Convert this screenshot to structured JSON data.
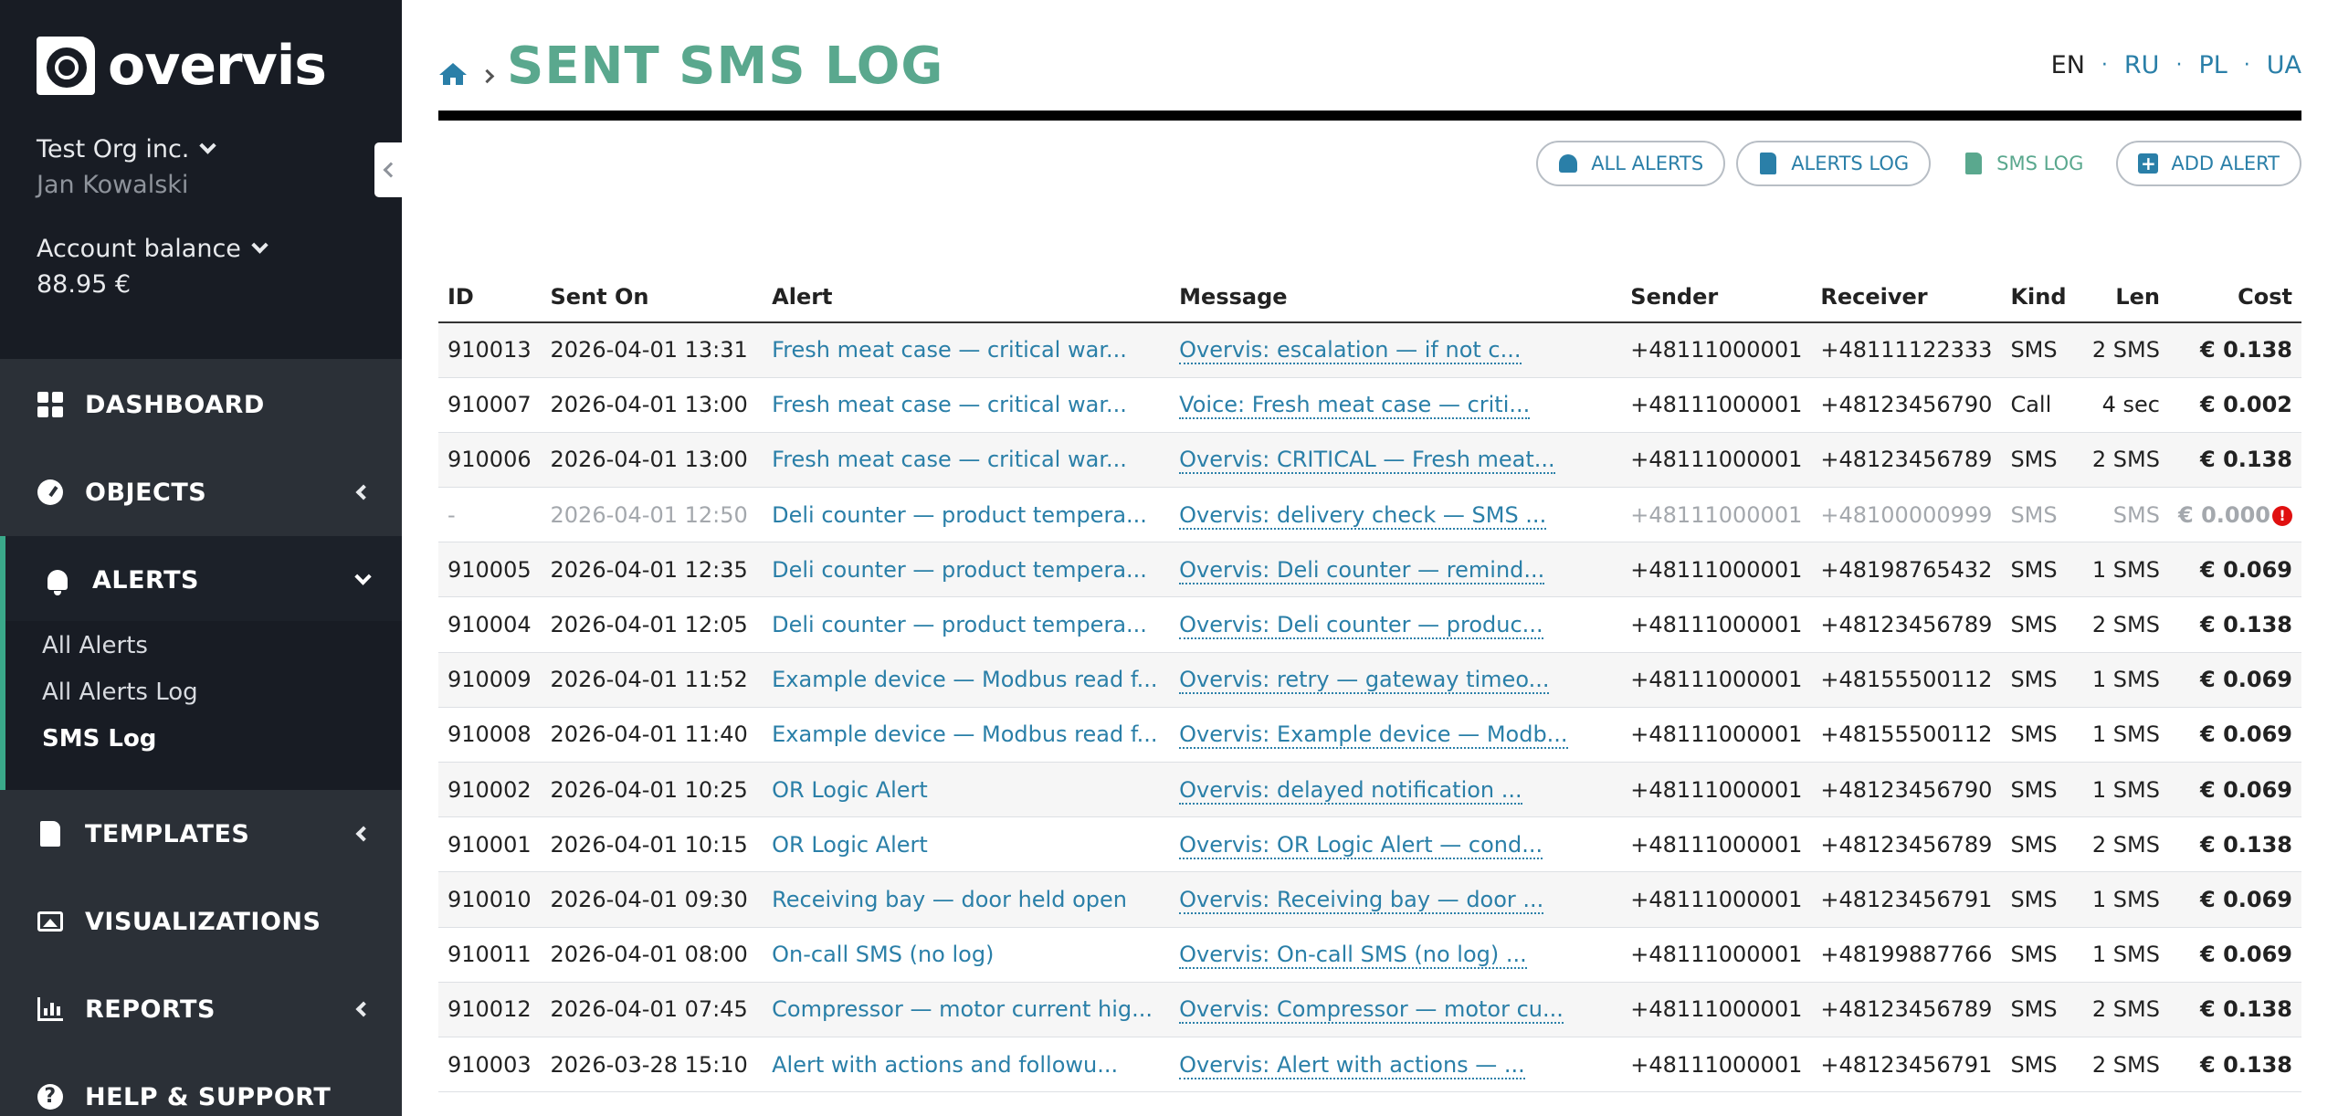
{
  "sidebar": {
    "logo_text": "overvis",
    "org_name": "Test Org inc.",
    "user_name": "Jan Kowalski",
    "balance_label": "Account balance",
    "balance_value": "88.95 €",
    "nav": [
      {
        "label": "DASHBOARD",
        "icon": "dashboard-icon"
      },
      {
        "label": "OBJECTS",
        "icon": "gauge-icon"
      },
      {
        "label": "ALERTS",
        "icon": "bell-icon"
      },
      {
        "label": "TEMPLATES",
        "icon": "file-icon"
      },
      {
        "label": "VISUALIZATIONS",
        "icon": "image-icon"
      },
      {
        "label": "REPORTS",
        "icon": "bar-chart-icon"
      },
      {
        "label": "HELP & SUPPORT",
        "icon": "help-icon"
      }
    ],
    "alerts_submenu": [
      "All Alerts",
      "All Alerts Log",
      "SMS Log"
    ]
  },
  "header": {
    "title": "SENT SMS LOG",
    "languages": [
      "EN",
      "RU",
      "PL",
      "UA"
    ],
    "current_language": "EN"
  },
  "actions": {
    "all_alerts": "ALL ALERTS",
    "alerts_log": "ALERTS LOG",
    "sms_log": "SMS LOG",
    "add_alert": "ADD ALERT"
  },
  "table": {
    "columns": [
      "ID",
      "Sent On",
      "Alert",
      "Message",
      "Sender",
      "Receiver",
      "Kind",
      "Len",
      "Cost"
    ],
    "rows": [
      {
        "id": "910013",
        "sent_on": "2026-04-01 13:31",
        "alert": "Fresh meat case — critical war...",
        "message": "Overvis: escalation — if not c...",
        "sender": "+48111000001",
        "receiver": "+48111122333",
        "kind": "SMS",
        "len": "2 SMS",
        "cost": "€ 0.138"
      },
      {
        "id": "910007",
        "sent_on": "2026-04-01 13:00",
        "alert": "Fresh meat case — critical war...",
        "message": "Voice: Fresh meat case — criti...",
        "sender": "+48111000001",
        "receiver": "+48123456790",
        "kind": "Call",
        "len": "4 sec",
        "cost": "€ 0.002"
      },
      {
        "id": "910006",
        "sent_on": "2026-04-01 13:00",
        "alert": "Fresh meat case — critical war...",
        "message": "Overvis: CRITICAL — Fresh meat...",
        "sender": "+48111000001",
        "receiver": "+48123456789",
        "kind": "SMS",
        "len": "2 SMS",
        "cost": "€ 0.138"
      },
      {
        "id": "-",
        "sent_on": "2026-04-01 12:50",
        "alert": "Deli counter — product tempera...",
        "message": "Overvis: delivery check — SMS ...",
        "sender": "+48111000001",
        "receiver": "+48100000999",
        "kind": "SMS",
        "len": "SMS",
        "cost": "€ 0.000",
        "failed": true
      },
      {
        "id": "910005",
        "sent_on": "2026-04-01 12:35",
        "alert": "Deli counter — product tempera...",
        "message": "Overvis: Deli counter — remind...",
        "sender": "+48111000001",
        "receiver": "+48198765432",
        "kind": "SMS",
        "len": "1 SMS",
        "cost": "€ 0.069"
      },
      {
        "id": "910004",
        "sent_on": "2026-04-01 12:05",
        "alert": "Deli counter — product tempera...",
        "message": "Overvis: Deli counter — produc...",
        "sender": "+48111000001",
        "receiver": "+48123456789",
        "kind": "SMS",
        "len": "2 SMS",
        "cost": "€ 0.138"
      },
      {
        "id": "910009",
        "sent_on": "2026-04-01 11:52",
        "alert": "Example device — Modbus read f...",
        "message": "Overvis: retry — gateway timeo...",
        "sender": "+48111000001",
        "receiver": "+48155500112",
        "kind": "SMS",
        "len": "1 SMS",
        "cost": "€ 0.069"
      },
      {
        "id": "910008",
        "sent_on": "2026-04-01 11:40",
        "alert": "Example device — Modbus read f...",
        "message": "Overvis: Example device — Modb...",
        "sender": "+48111000001",
        "receiver": "+48155500112",
        "kind": "SMS",
        "len": "1 SMS",
        "cost": "€ 0.069"
      },
      {
        "id": "910002",
        "sent_on": "2026-04-01 10:25",
        "alert": "OR Logic Alert",
        "message": "Overvis: delayed notification ...",
        "sender": "+48111000001",
        "receiver": "+48123456790",
        "kind": "SMS",
        "len": "1 SMS",
        "cost": "€ 0.069"
      },
      {
        "id": "910001",
        "sent_on": "2026-04-01 10:15",
        "alert": "OR Logic Alert",
        "message": "Overvis: OR Logic Alert — cond...",
        "sender": "+48111000001",
        "receiver": "+48123456789",
        "kind": "SMS",
        "len": "2 SMS",
        "cost": "€ 0.138"
      },
      {
        "id": "910010",
        "sent_on": "2026-04-01 09:30",
        "alert": "Receiving bay — door held open",
        "message": "Overvis: Receiving bay — door ...",
        "sender": "+48111000001",
        "receiver": "+48123456791",
        "kind": "SMS",
        "len": "1 SMS",
        "cost": "€ 0.069"
      },
      {
        "id": "910011",
        "sent_on": "2026-04-01 08:00",
        "alert": "On-call SMS (no log)",
        "message": "Overvis: On-call SMS (no log) ...",
        "sender": "+48111000001",
        "receiver": "+48199887766",
        "kind": "SMS",
        "len": "1 SMS",
        "cost": "€ 0.069"
      },
      {
        "id": "910012",
        "sent_on": "2026-04-01 07:45",
        "alert": "Compressor — motor current hig...",
        "message": "Overvis: Compressor — motor cu...",
        "sender": "+48111000001",
        "receiver": "+48123456789",
        "kind": "SMS",
        "len": "2 SMS",
        "cost": "€ 0.138"
      },
      {
        "id": "910003",
        "sent_on": "2026-03-28 15:10",
        "alert": "Alert with actions and followu...",
        "message": "Overvis: Alert with actions — ...",
        "sender": "+48111000001",
        "receiver": "+48123456791",
        "kind": "SMS",
        "len": "2 SMS",
        "cost": "€ 0.138"
      }
    ]
  },
  "colors": {
    "sidebar_bg": "#2b3037",
    "sidebar_top_bg": "#181c24",
    "accent_green": "#5aa88e",
    "link_blue": "#2a7fa8",
    "error_red": "#e01010"
  }
}
